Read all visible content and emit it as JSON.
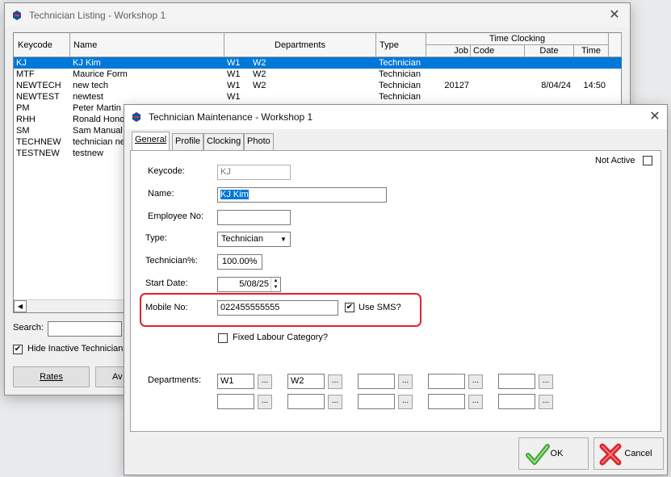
{
  "listing": {
    "title": "Technician Listing - Workshop 1",
    "headers": {
      "keycode": "Keycode",
      "name": "Name",
      "departments": "Departments",
      "type": "Type",
      "time_clocking": "Time Clocking",
      "job": "Job",
      "code": "Code",
      "date": "Date",
      "time": "Time"
    },
    "rows": [
      {
        "keycode": "KJ",
        "name": "KJ Kim",
        "dep1": "W1",
        "dep2": "W2",
        "type": "Technician",
        "job": "",
        "date": "",
        "time": ""
      },
      {
        "keycode": "MTF",
        "name": "Maurice Form",
        "dep1": "W1",
        "dep2": "W2",
        "type": "Technician",
        "job": "",
        "date": "",
        "time": ""
      },
      {
        "keycode": "NEWTECH",
        "name": "new tech",
        "dep1": "W1",
        "dep2": "W2",
        "type": "Technician",
        "job": "20127",
        "date": "8/04/24",
        "time": "14:50"
      },
      {
        "keycode": "NEWTEST",
        "name": "newtest",
        "dep1": "W1",
        "dep2": "",
        "type": "Technician",
        "job": "",
        "date": "",
        "time": ""
      },
      {
        "keycode": "PM",
        "name": "Peter Martin",
        "dep1": "",
        "dep2": "",
        "type": "",
        "job": "",
        "date": "",
        "time": ""
      },
      {
        "keycode": "RHH",
        "name": "Ronald Honou",
        "dep1": "",
        "dep2": "",
        "type": "",
        "job": "",
        "date": "",
        "time": ""
      },
      {
        "keycode": "SM",
        "name": "Sam Manual",
        "dep1": "",
        "dep2": "",
        "type": "",
        "job": "",
        "date": "",
        "time": ""
      },
      {
        "keycode": "TECHNEW",
        "name": "technician ne",
        "dep1": "",
        "dep2": "",
        "type": "",
        "job": "",
        "date": "",
        "time": ""
      },
      {
        "keycode": "TESTNEW",
        "name": "testnew",
        "dep1": "",
        "dep2": "",
        "type": "",
        "job": "",
        "date": "",
        "time": ""
      }
    ],
    "search_label": "Search:",
    "search_value": "",
    "hide_inactive_label": "Hide Inactive Technicians",
    "hide_inactive_checked": true,
    "rates_label": "Rates",
    "av_label": "Av"
  },
  "maintenance": {
    "title": "Technician Maintenance - Workshop 1",
    "tabs": [
      "General",
      "Profile",
      "Clocking",
      "Photo"
    ],
    "not_active_label": "Not Active",
    "keycode_label": "Keycode:",
    "keycode_value": "KJ",
    "name_label": "Name:",
    "name_value": "KJ Kim",
    "employee_no_label": "Employee No:",
    "employee_no_value": "",
    "type_label": "Type:",
    "type_value": "Technician",
    "technician_pct_label": "Technician%:",
    "technician_pct_value": "100.00%",
    "start_date_label": "Start Date:",
    "start_date_value": "5/08/25",
    "mobile_label": "Mobile No:",
    "mobile_value": "022455555555",
    "use_sms_label": "Use SMS?",
    "use_sms_checked": true,
    "fixed_labour_label": "Fixed Labour Category?",
    "departments_label": "Departments:",
    "departments": [
      "W1",
      "W2",
      "",
      "",
      "",
      "",
      "",
      "",
      "",
      ""
    ],
    "ok_label": "OK",
    "cancel_label": "Cancel"
  },
  "colors": {
    "selection": "#0078d7",
    "highlight": "#e0232a",
    "ok_green": "#3fa535",
    "cancel_red": "#d9262c"
  }
}
